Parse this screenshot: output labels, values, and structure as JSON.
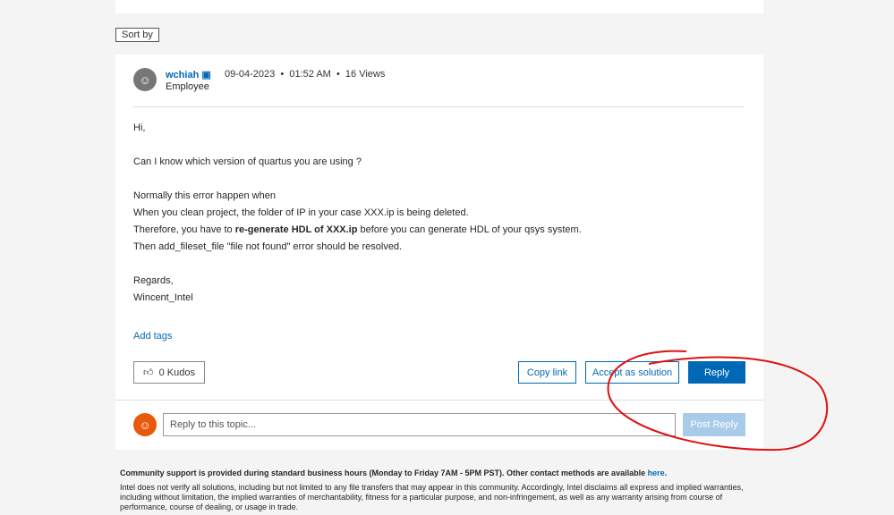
{
  "sort_label": "Sort by",
  "post": {
    "author": "wchiah",
    "role": "Employee",
    "date": "09-04-2023",
    "time": "01:52 AM",
    "views": "16 Views",
    "lines": [
      "Hi,",
      "",
      "Can I know which version of quartus you are using ?",
      "",
      "Normally this error happen when",
      "When you clean project, the folder of IP in your case XXX.ip is being deleted."
    ],
    "line_pre": "Therefore, you have to ",
    "line_bold": "re-generate HDL of XXX.ip",
    "line_post": " before you can generate HDL of your qsys system.",
    "line_last": "Then add_fileset_file \"file not found\" error should be resolved.",
    "regards": "Regards,",
    "signature": "Wincent_Intel"
  },
  "add_tags": "Add tags",
  "kudos": "0 Kudos",
  "copy_link": "Copy link",
  "accept": "Accept as solution",
  "reply": "Reply",
  "reply_placeholder": "Reply to this topic...",
  "post_reply": "Post Reply",
  "footer": {
    "support": "Community support is provided during standard business hours (Monday to Friday 7AM - 5PM PST). Other contact methods are available ",
    "here": "here",
    "disclaimer": "Intel does not verify all solutions, including but not limited to any file transfers that may appear in this community. Accordingly, Intel disclaims all express and implied warranties, including without limitation, the implied warranties of merchantability, fitness for a particular purpose, and non-infringement, as well as any warranty arising from course of performance, course of dealing, or usage in trade."
  }
}
